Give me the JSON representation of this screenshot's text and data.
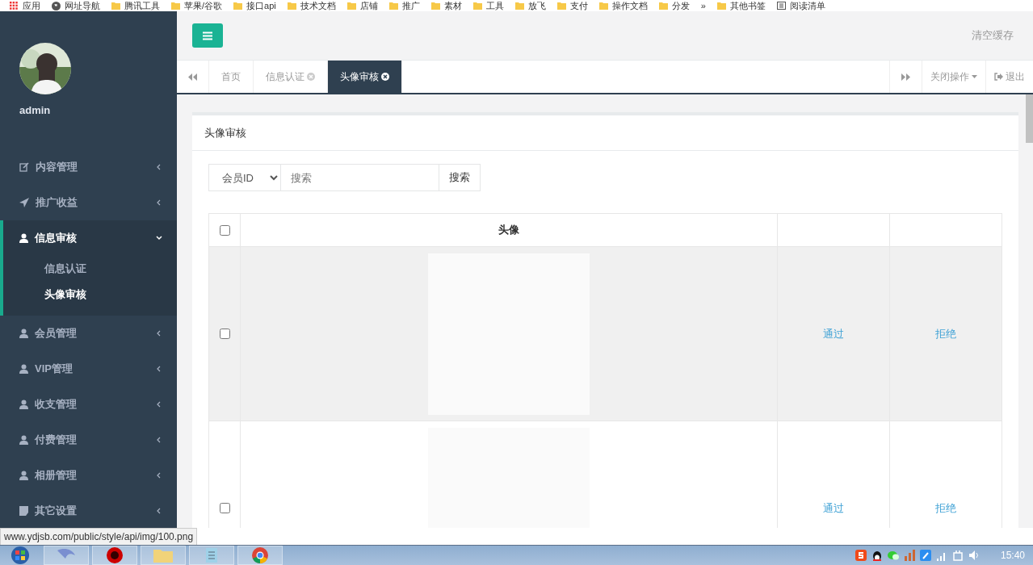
{
  "bookmarks": [
    {
      "label": "应用",
      "kind": "apps"
    },
    {
      "label": "网址导航",
      "kind": "globe"
    },
    {
      "label": "腾讯工具",
      "kind": "folder"
    },
    {
      "label": "苹果/谷歌",
      "kind": "folder"
    },
    {
      "label": "接口api",
      "kind": "folder"
    },
    {
      "label": "技术文档",
      "kind": "folder"
    },
    {
      "label": "店铺",
      "kind": "folder"
    },
    {
      "label": "推广",
      "kind": "folder"
    },
    {
      "label": "素材",
      "kind": "folder"
    },
    {
      "label": "工具",
      "kind": "folder"
    },
    {
      "label": "放飞",
      "kind": "folder"
    },
    {
      "label": "支付",
      "kind": "folder"
    },
    {
      "label": "操作文档",
      "kind": "folder"
    },
    {
      "label": "分发",
      "kind": "folder"
    },
    {
      "label": "»",
      "kind": "more"
    },
    {
      "label": "其他书签",
      "kind": "folder"
    },
    {
      "label": "阅读清单",
      "kind": "list"
    }
  ],
  "sidebar": {
    "user": "admin",
    "items": [
      {
        "label": "内容管理",
        "kind": "edit",
        "expanded": false
      },
      {
        "label": "推广收益",
        "kind": "send",
        "expanded": false
      },
      {
        "label": "信息审核",
        "kind": "user",
        "expanded": true,
        "children": [
          {
            "label": "信息认证",
            "selected": false
          },
          {
            "label": "头像审核",
            "selected": true
          }
        ]
      },
      {
        "label": "会员管理",
        "kind": "user",
        "expanded": false
      },
      {
        "label": "VIP管理",
        "kind": "user",
        "expanded": false
      },
      {
        "label": "收支管理",
        "kind": "user",
        "expanded": false
      },
      {
        "label": "付费管理",
        "kind": "user",
        "expanded": false
      },
      {
        "label": "相册管理",
        "kind": "user",
        "expanded": false
      },
      {
        "label": "其它设置",
        "kind": "book",
        "expanded": false
      }
    ]
  },
  "header": {
    "clear_cache": "清空缓存"
  },
  "tabs": [
    {
      "label": "首页",
      "closable": false,
      "selected": false
    },
    {
      "label": "信息认证",
      "closable": true,
      "selected": false
    },
    {
      "label": "头像审核",
      "closable": true,
      "selected": true
    }
  ],
  "tab_tools": {
    "close_ops": "关闭操作",
    "logout": "退出"
  },
  "panel": {
    "title": "头像审核",
    "search": {
      "filter": "会员ID",
      "placeholder": "搜索",
      "button": "搜索"
    },
    "table": {
      "columns": [
        "头像"
      ],
      "header_checked": false,
      "rows": [
        {
          "checked": false,
          "hovered": true,
          "actions": [
            "通过",
            "拒绝"
          ]
        },
        {
          "checked": false,
          "hovered": false,
          "actions": [
            "通过",
            "拒绝"
          ]
        }
      ]
    }
  },
  "status_url": "www.ydjsb.com/public/style/api/img/100.png",
  "taskbar": {
    "time": "15:40"
  }
}
